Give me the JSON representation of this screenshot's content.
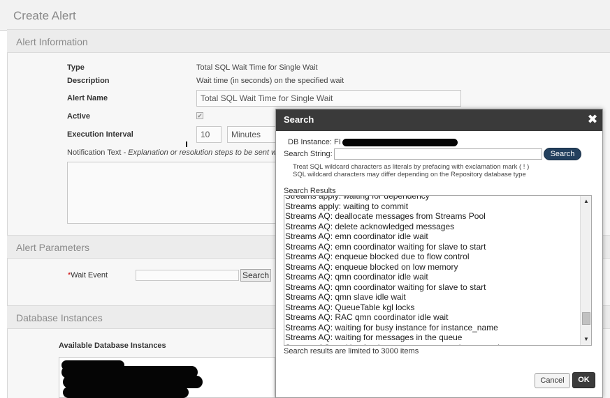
{
  "page": {
    "title": "Create Alert"
  },
  "alert_info": {
    "header": "Alert Information",
    "type_label": "Type",
    "type_value": "Total SQL Wait Time for Single Wait",
    "description_label": "Description",
    "description_value": "Wait time (in seconds) on the specified wait",
    "name_label": "Alert Name",
    "name_value": "Total SQL Wait Time for Single Wait",
    "active_label": "Active",
    "active_checked": "✔",
    "interval_label": "Execution Interval",
    "interval_value": "10",
    "interval_unit": "Minutes",
    "notification_label": "Notification Text",
    "notification_hint": " - Explanation or resolution steps to be sent wit"
  },
  "alert_params": {
    "header": "Alert Parameters",
    "required_mark": "*",
    "wait_event_label": "Wait Event",
    "search_button": "Search"
  },
  "db_instances": {
    "header": "Database Instances",
    "available_label": "Available Database Instances"
  },
  "search_dialog": {
    "title": "Search",
    "close_glyph": "✖",
    "db_instance_label": "DB Instance: FI",
    "search_string_label": "Search String:",
    "search_button": "Search",
    "hint1": "Treat SQL wildcard characters as literals by prefacing with exclamation mark ( ! )",
    "hint2": "SQL wildcard characters may differ depending on the Repository database type",
    "results_label": "Search Results",
    "results": [
      "Streams apply: waiting for dependency",
      "Streams apply: waiting to commit",
      "Streams AQ: deallocate messages from Streams Pool",
      "Streams AQ: delete acknowledged messages",
      "Streams AQ: emn coordinator idle wait",
      "Streams AQ: emn coordinator waiting for slave to start",
      "Streams AQ: enqueue blocked due to flow control",
      "Streams AQ: enqueue blocked on low memory",
      "Streams AQ: qmn coordinator idle wait",
      "Streams AQ: qmn coordinator waiting for slave to start",
      "Streams AQ: qmn slave idle wait",
      "Streams AQ: QueueTable kgl locks",
      "Streams AQ: RAC qmn coordinator idle wait",
      "Streams AQ: waiting for busy instance for instance_name",
      "Streams AQ: waiting for messages in the queue",
      "Streams AQ: waiting for time management or cleanup tasks"
    ],
    "limit_note": "Search results are limited to 3000 items",
    "cancel_button": "Cancel",
    "ok_button": "OK",
    "scroll_up": "▲",
    "scroll_down": "▼"
  }
}
